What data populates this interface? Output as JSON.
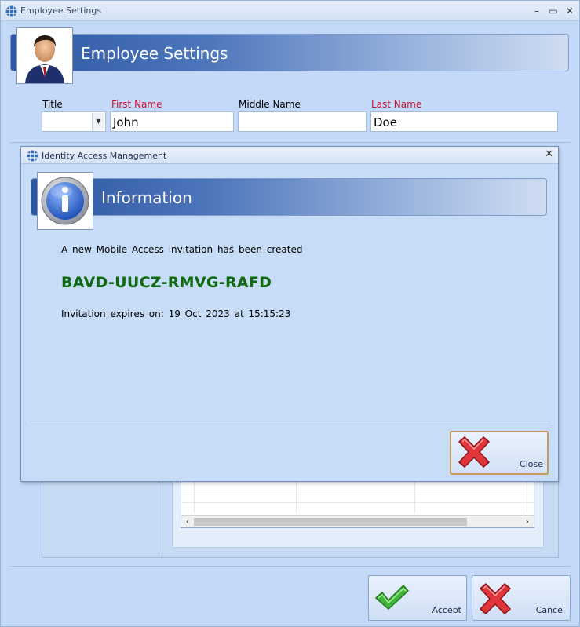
{
  "window": {
    "title": "Employee Settings"
  },
  "header": {
    "title": "Employee Settings"
  },
  "form": {
    "title_label": "Title",
    "title_value": "",
    "first_name_label": "First Name",
    "first_name_value": "John",
    "middle_name_label": "Middle Name",
    "middle_name_value": "",
    "last_name_label": "Last Name",
    "last_name_value": "Doe"
  },
  "dialog": {
    "title": "Identity Access Management",
    "banner_title": "Information",
    "message": "A new Mobile Access invitation has been created",
    "code": "BAVD-UUCZ-RMVG-RAFD",
    "expiry": "Invitation expires on: 19 Oct 2023 at 15:15:23",
    "close_label": "Close"
  },
  "footer": {
    "accept_label": "Accept",
    "cancel_label": "Cancel"
  },
  "colors": {
    "accent": "#2c56a2",
    "required_label": "#c8102e",
    "code_text": "#0f6a0f",
    "close_highlight": "#c89a5a"
  },
  "icons": {
    "app": "grid-globe-icon",
    "employee": "person-avatar-icon",
    "info": "info-icon",
    "accept": "checkmark-icon",
    "cancel": "cross-icon"
  }
}
